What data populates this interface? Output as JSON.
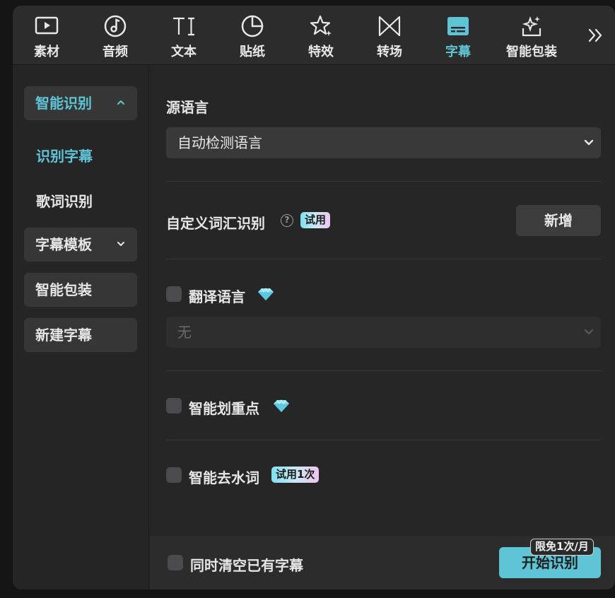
{
  "toolbar": {
    "tabs": [
      {
        "label": "素材",
        "icon": "media-play-icon"
      },
      {
        "label": "音频",
        "icon": "music-note-icon"
      },
      {
        "label": "文本",
        "icon": "text-ti-icon"
      },
      {
        "label": "贴纸",
        "icon": "sticker-icon"
      },
      {
        "label": "特效",
        "icon": "effects-star-icon"
      },
      {
        "label": "转场",
        "icon": "transition-icon"
      },
      {
        "label": "字幕",
        "icon": "subtitle-icon",
        "active": true
      },
      {
        "label": "智能包装",
        "icon": "smart-package-icon"
      }
    ],
    "more_icon": "double-chevron-right-icon"
  },
  "sidebar": {
    "items": [
      {
        "label": "智能识别",
        "expanded": true
      },
      {
        "label": "识别字幕",
        "active": true
      },
      {
        "label": "歌词识别"
      },
      {
        "label": "字幕模板",
        "expanded": false
      },
      {
        "label": "智能包装"
      },
      {
        "label": "新建字幕"
      }
    ]
  },
  "main": {
    "source_language": {
      "title": "源语言",
      "value": "自动检测语言"
    },
    "custom_vocab": {
      "title": "自定义词汇识别",
      "badge": "试用",
      "add_label": "新增"
    },
    "translate": {
      "label": "翻译语言",
      "value": "无",
      "checked": false
    },
    "highlight": {
      "label": "智能划重点",
      "checked": false
    },
    "filler_removal": {
      "label": "智能去水词",
      "badge": "试用1次",
      "checked": false
    }
  },
  "footer": {
    "clear_existing": {
      "label": "同时清空已有字幕",
      "checked": false
    },
    "start_label": "开始识别",
    "quota_label": "限免1次/月"
  },
  "colors": {
    "accent": "#5ec4d6",
    "panel": "#262626",
    "control": "#393939"
  }
}
